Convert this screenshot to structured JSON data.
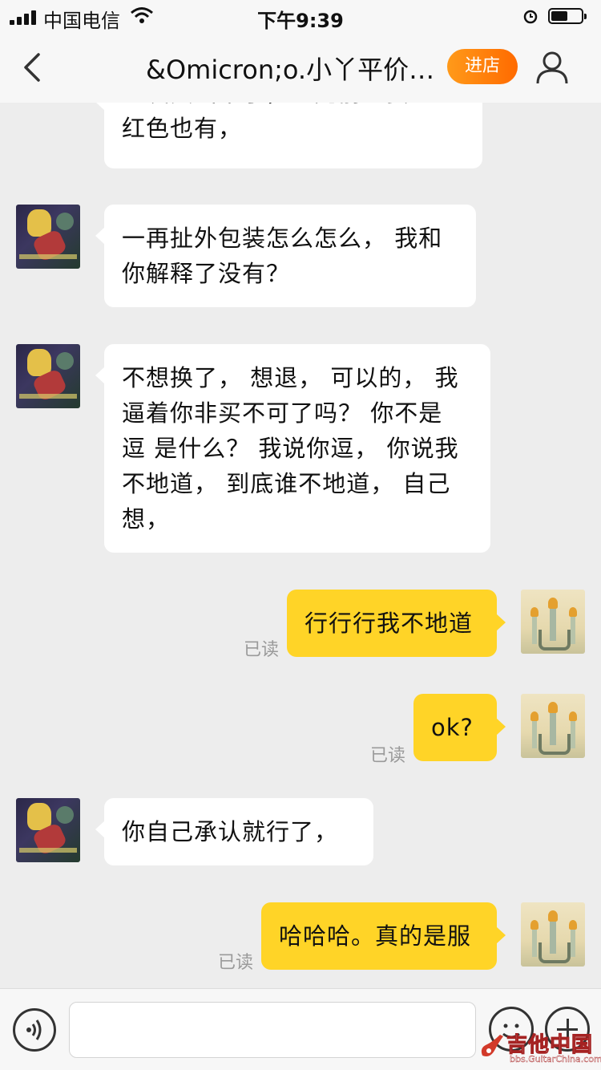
{
  "status_bar": {
    "carrier": "中国电信",
    "time": "下午9:39"
  },
  "header": {
    "title": "&Omicron;o.小丫平价…",
    "enter_shop_label": "进店"
  },
  "messages": [
    {
      "side": "left",
      "lines": [
        "红发货出来了，您先前想要的",
        "红色也有，"
      ]
    },
    {
      "side": "left",
      "lines": [
        "一再扯外包装怎么怎么， 我和",
        "你解释了没有？"
      ]
    },
    {
      "side": "left",
      "lines": [
        "不想换了， 想退， 可以的， 我",
        "逼着你非买不可了吗？ 你不是",
        "逗 是什么？ 我说你逗， 你说我",
        "不地道， 到底谁不地道， 自己",
        "想，"
      ]
    },
    {
      "side": "right",
      "lines": [
        "行行行我不地道"
      ],
      "status": "已读"
    },
    {
      "side": "right",
      "lines": [
        "ok?"
      ],
      "status": "已读"
    },
    {
      "side": "left",
      "lines": [
        "你自己承认就行了，"
      ]
    },
    {
      "side": "right",
      "lines": [
        "哈哈哈。真的是服"
      ],
      "status": "已读"
    }
  ],
  "input": {
    "placeholder": ""
  },
  "watermark": {
    "name": "吉他中国",
    "url": "bbs.GuitarChina.com"
  },
  "colors": {
    "outgoing_bubble": "#ffd427",
    "incoming_bubble": "#ffffff",
    "shop_button": "#ff7d0d",
    "background": "#ededed"
  }
}
